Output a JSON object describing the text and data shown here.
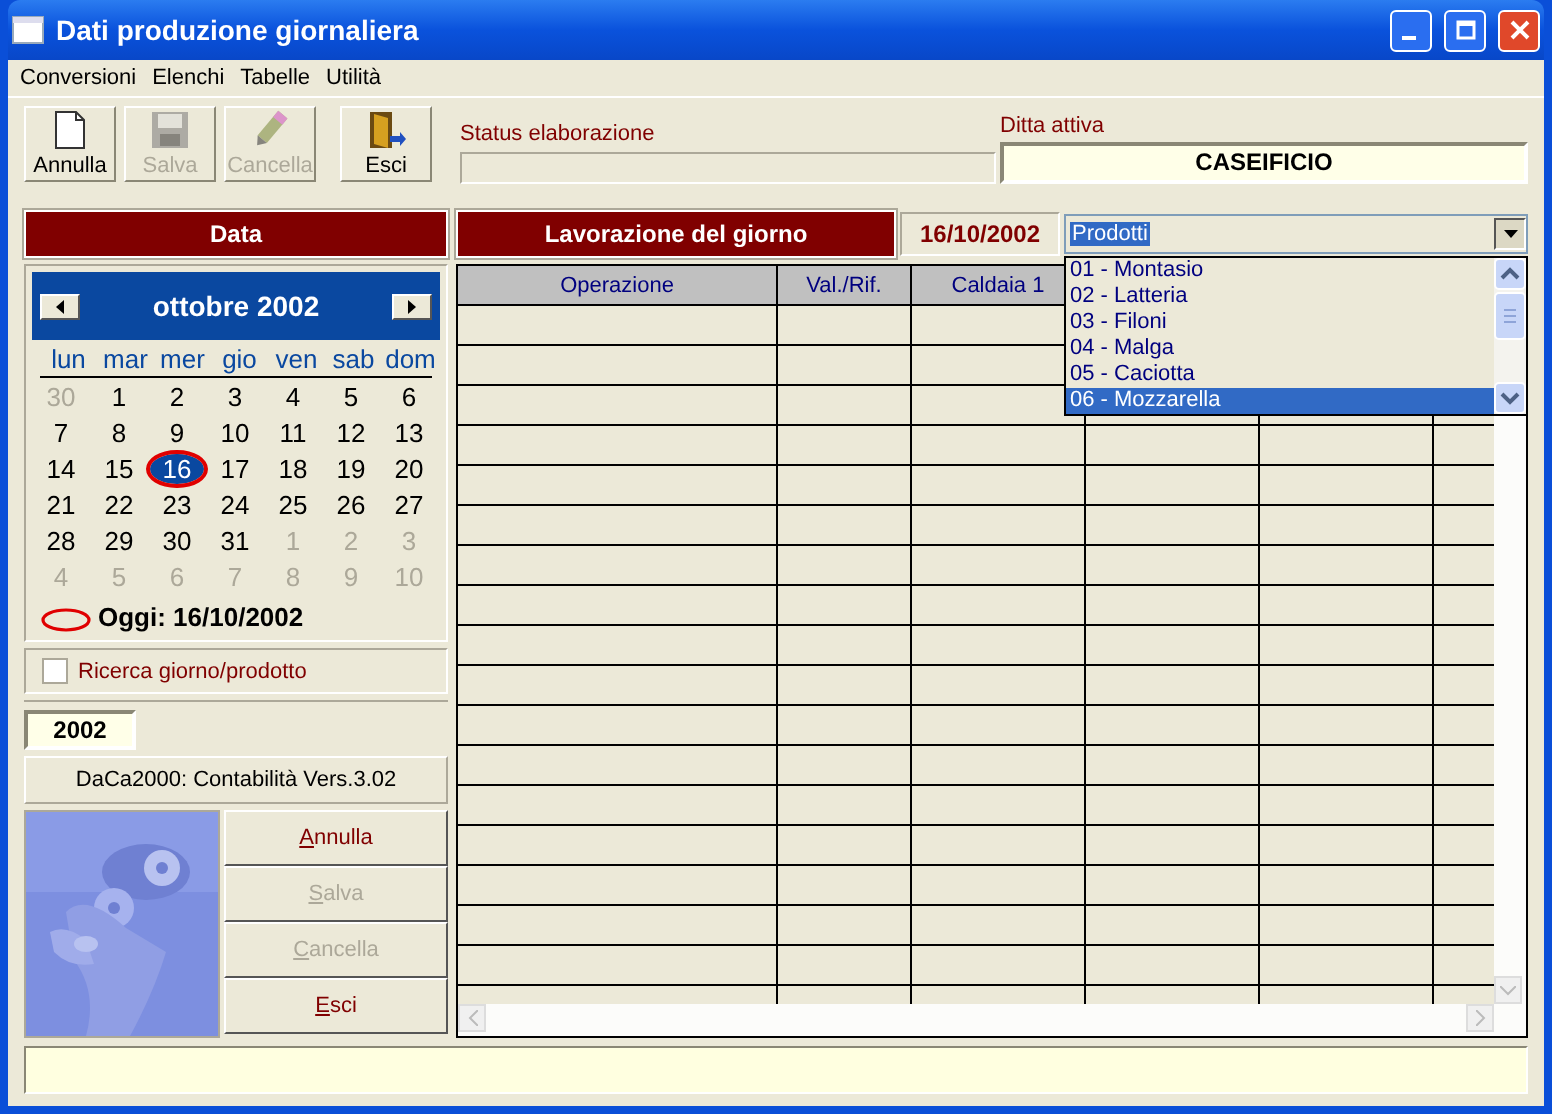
{
  "window": {
    "title": "Dati produzione giornaliera"
  },
  "menu": [
    "Conversioni",
    "Elenchi",
    "Tabelle",
    "Utilità"
  ],
  "toolbar": [
    {
      "label": "Annulla",
      "kind": "new",
      "disabled": false
    },
    {
      "label": "Salva",
      "kind": "save",
      "disabled": true
    },
    {
      "label": "Cancella",
      "kind": "erase",
      "disabled": true
    },
    {
      "label": "Esci",
      "kind": "exit",
      "disabled": false
    }
  ],
  "status": {
    "label": "Status elaborazione"
  },
  "company": {
    "label": "Ditta attiva",
    "value": "CASEIFICIO"
  },
  "date_panel": {
    "title": "Data"
  },
  "calendar": {
    "month": "ottobre 2002",
    "weekdays": [
      "lun",
      "mar",
      "mer",
      "gio",
      "ven",
      "sab",
      "dom"
    ],
    "weeks": [
      [
        {
          "day": "30",
          "muted": true,
          "selected": false
        },
        {
          "day": "1",
          "muted": false,
          "selected": false
        },
        {
          "day": "2",
          "muted": false,
          "selected": false
        },
        {
          "day": "3",
          "muted": false,
          "selected": false
        },
        {
          "day": "4",
          "muted": false,
          "selected": false
        },
        {
          "day": "5",
          "muted": false,
          "selected": false
        },
        {
          "day": "6",
          "muted": false,
          "selected": false
        }
      ],
      [
        {
          "day": "7",
          "muted": false,
          "selected": false
        },
        {
          "day": "8",
          "muted": false,
          "selected": false
        },
        {
          "day": "9",
          "muted": false,
          "selected": false
        },
        {
          "day": "10",
          "muted": false,
          "selected": false
        },
        {
          "day": "11",
          "muted": false,
          "selected": false
        },
        {
          "day": "12",
          "muted": false,
          "selected": false
        },
        {
          "day": "13",
          "muted": false,
          "selected": false
        }
      ],
      [
        {
          "day": "14",
          "muted": false,
          "selected": false
        },
        {
          "day": "15",
          "muted": false,
          "selected": false
        },
        {
          "day": "16",
          "muted": false,
          "selected": true
        },
        {
          "day": "17",
          "muted": false,
          "selected": false
        },
        {
          "day": "18",
          "muted": false,
          "selected": false
        },
        {
          "day": "19",
          "muted": false,
          "selected": false
        },
        {
          "day": "20",
          "muted": false,
          "selected": false
        }
      ],
      [
        {
          "day": "21",
          "muted": false,
          "selected": false
        },
        {
          "day": "22",
          "muted": false,
          "selected": false
        },
        {
          "day": "23",
          "muted": false,
          "selected": false
        },
        {
          "day": "24",
          "muted": false,
          "selected": false
        },
        {
          "day": "25",
          "muted": false,
          "selected": false
        },
        {
          "day": "26",
          "muted": false,
          "selected": false
        },
        {
          "day": "27",
          "muted": false,
          "selected": false
        }
      ],
      [
        {
          "day": "28",
          "muted": false,
          "selected": false
        },
        {
          "day": "29",
          "muted": false,
          "selected": false
        },
        {
          "day": "30",
          "muted": false,
          "selected": false
        },
        {
          "day": "31",
          "muted": false,
          "selected": false
        },
        {
          "day": "1",
          "muted": true,
          "selected": false
        },
        {
          "day": "2",
          "muted": true,
          "selected": false
        },
        {
          "day": "3",
          "muted": true,
          "selected": false
        }
      ],
      [
        {
          "day": "4",
          "muted": true,
          "selected": false
        },
        {
          "day": "5",
          "muted": true,
          "selected": false
        },
        {
          "day": "6",
          "muted": true,
          "selected": false
        },
        {
          "day": "7",
          "muted": true,
          "selected": false
        },
        {
          "day": "8",
          "muted": true,
          "selected": false
        },
        {
          "day": "9",
          "muted": true,
          "selected": false
        },
        {
          "day": "10",
          "muted": true,
          "selected": false
        }
      ]
    ],
    "today_label": "Oggi: 16/10/2002"
  },
  "search_option": {
    "label": "Ricerca giorno/prodotto",
    "checked": false
  },
  "year": "2002",
  "version": "DaCa2000: Contabilità Vers.3.02",
  "side_buttons": [
    {
      "label": "Annulla",
      "disabled": false
    },
    {
      "label": "Salva",
      "disabled": true
    },
    {
      "label": "Cancella",
      "disabled": true
    },
    {
      "label": "Esci",
      "disabled": false
    }
  ],
  "work": {
    "title": "Lavorazione del giorno",
    "date": "16/10/2002",
    "product_combo": {
      "value": "Prodotti",
      "expanded": true,
      "options": [
        {
          "label": "01 - Montasio",
          "selected": false
        },
        {
          "label": "02 - Latteria",
          "selected": false
        },
        {
          "label": "03 - Filoni",
          "selected": false
        },
        {
          "label": "04 - Malga",
          "selected": false
        },
        {
          "label": "05 - Caciotta",
          "selected": false
        },
        {
          "label": "06 - Mozzarella",
          "selected": true
        }
      ]
    }
  },
  "grid": {
    "columns": [
      "Operazione",
      "Val./Rif.",
      "Caldaia 1"
    ]
  }
}
